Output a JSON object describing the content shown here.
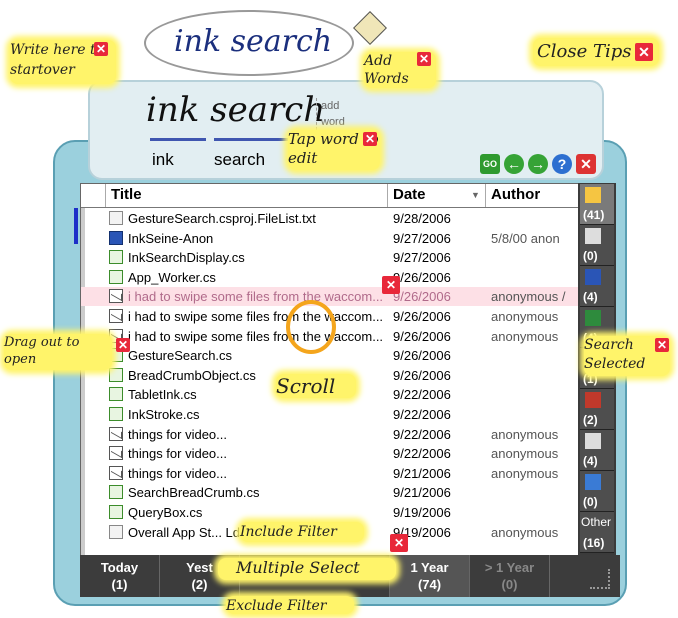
{
  "ink_area": {
    "written": "ink search"
  },
  "close_tips": {
    "label": "Close Tips"
  },
  "tips": {
    "write_here": "Write here to startover",
    "add_words": "Add Words",
    "tap_word": "Tap word to edit",
    "drag_out": "Drag out to open",
    "scroll": "Scroll",
    "search_selected": "Search Selected",
    "include_filter": "Include Filter",
    "multiple_select": "Multiple Select",
    "exclude_filter": "Exclude Filter"
  },
  "recognition": {
    "ink_text": "ink search",
    "add_word": "add word",
    "word1": "ink",
    "word2": "search"
  },
  "toolbar": {
    "go": "GO",
    "help": "?"
  },
  "table": {
    "headers": {
      "title": "Title",
      "date": "Date",
      "author": "Author"
    },
    "rows": [
      {
        "icon": "file-icon",
        "title": "GestureSearch.csproj.FileList.txt",
        "date": "9/28/2006",
        "author": ""
      },
      {
        "icon": "word-icon",
        "title": "InkSeine-Anon",
        "date": "9/27/2006",
        "author": "5/8/00 anon"
      },
      {
        "icon": "cs-file-icon",
        "title": "InkSearchDisplay.cs",
        "date": "9/27/2006",
        "author": ""
      },
      {
        "icon": "cs-file-icon",
        "title": "App_Worker.cs",
        "date": "9/26/2006",
        "author": ""
      },
      {
        "icon": "mail-icon",
        "title": "i had to swipe some files from the waccom...",
        "date": "9/26/2006",
        "author": "anonymous /"
      },
      {
        "icon": "mail-icon",
        "title": "i had to swipe some files from the waccom...",
        "date": "9/26/2006",
        "author": "anonymous"
      },
      {
        "icon": "mail-icon",
        "title": "i had to swipe some files from the waccom...",
        "date": "9/26/2006",
        "author": "anonymous"
      },
      {
        "icon": "cs-file-icon",
        "title": "GestureSearch.cs",
        "date": "9/26/2006",
        "author": ""
      },
      {
        "icon": "cs-file-icon",
        "title": "BreadCrumbObject.cs",
        "date": "9/26/2006",
        "author": ""
      },
      {
        "icon": "cs-file-icon",
        "title": "TabletInk.cs",
        "date": "9/22/2006",
        "author": ""
      },
      {
        "icon": "cs-file-icon",
        "title": "InkStroke.cs",
        "date": "9/22/2006",
        "author": ""
      },
      {
        "icon": "mail-icon",
        "title": "things for video...",
        "date": "9/22/2006",
        "author": "anonymous"
      },
      {
        "icon": "mail-icon",
        "title": "things for video...",
        "date": "9/22/2006",
        "author": "anonymous"
      },
      {
        "icon": "mail-icon",
        "title": "things for video...",
        "date": "9/21/2006",
        "author": "anonymous"
      },
      {
        "icon": "cs-file-icon",
        "title": "SearchBreadCrumb.cs",
        "date": "9/21/2006",
        "author": ""
      },
      {
        "icon": "cs-file-icon",
        "title": "QueryBox.cs",
        "date": "9/19/2006",
        "author": ""
      },
      {
        "icon": "file-icon",
        "title": "Overall App St... Ld...",
        "date": "9/19/2006",
        "author": "anonymous"
      }
    ]
  },
  "sidebar": [
    {
      "icon": "mail-icon",
      "count": "(41)"
    },
    {
      "icon": "image-icon",
      "count": "(0)"
    },
    {
      "icon": "word-icon",
      "count": "(4)"
    },
    {
      "icon": "excel-icon",
      "count": "(4)"
    },
    {
      "icon": "file-icon",
      "count": "(1)"
    },
    {
      "icon": "pdf-icon",
      "count": "(2)"
    },
    {
      "icon": "image-icon",
      "count": "(4)"
    },
    {
      "icon": "ie-icon",
      "count": "(0)"
    },
    {
      "icon": "other-icon",
      "label": "Other",
      "count": "(16)"
    }
  ],
  "timebar": [
    {
      "label": "Today",
      "count": "(1)"
    },
    {
      "label": "Yest",
      "count": "(2)"
    },
    {
      "label": "",
      "count": ""
    },
    {
      "label": "1 Year",
      "count": "(74)"
    },
    {
      "label": "> 1 Year",
      "count": "(0)"
    }
  ],
  "colors": {
    "frame": "#9bd0dd",
    "highlight": "#fff46a",
    "close_red": "#e8283a",
    "dark_bar": "#3c3c3c"
  }
}
